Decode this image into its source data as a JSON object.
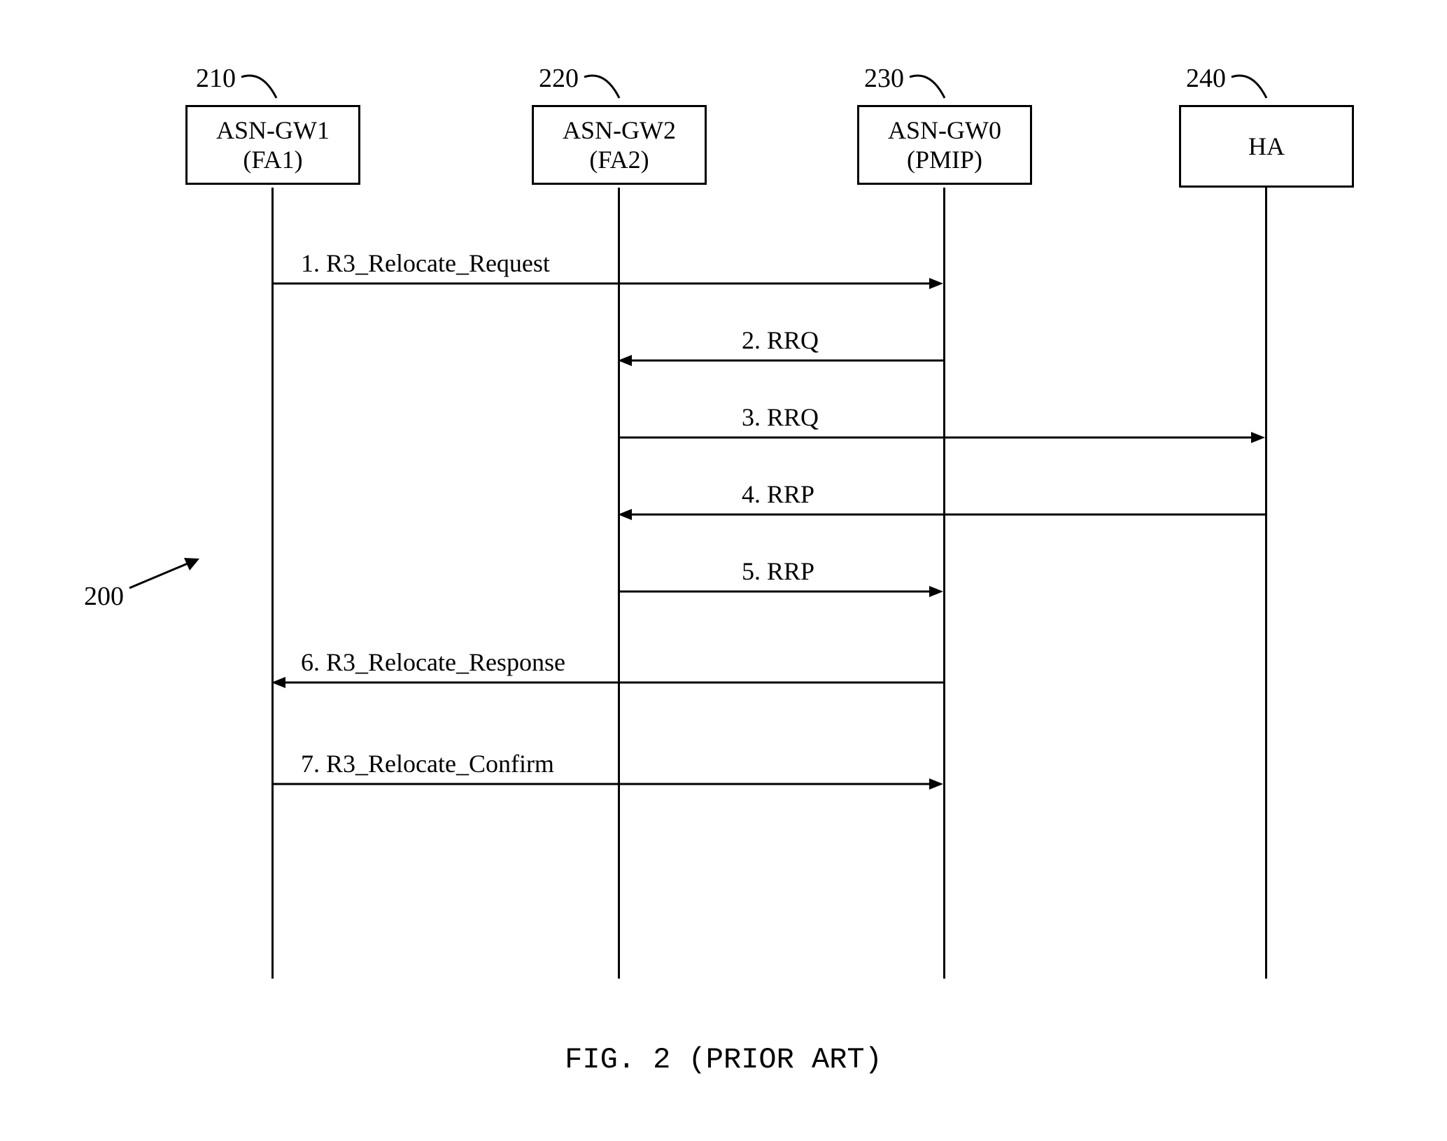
{
  "participants": [
    {
      "id": "p1",
      "ref": "210",
      "line1": "ASN-GW1",
      "line2": "(FA1)"
    },
    {
      "id": "p2",
      "ref": "220",
      "line1": "ASN-GW2",
      "line2": "(FA2)"
    },
    {
      "id": "p3",
      "ref": "230",
      "line1": "ASN-GW0",
      "line2": "(PMIP)"
    },
    {
      "id": "p4",
      "ref": "240",
      "line1": "HA",
      "line2": ""
    }
  ],
  "messages": [
    {
      "num": "1",
      "label": "1. R3_Relocate_Request"
    },
    {
      "num": "2",
      "label": "2. RRQ"
    },
    {
      "num": "3",
      "label": "3. RRQ"
    },
    {
      "num": "4",
      "label": "4. RRP"
    },
    {
      "num": "5",
      "label": "5. RRP"
    },
    {
      "num": "6",
      "label": "6. R3_Relocate_Response"
    },
    {
      "num": "7",
      "label": "7. R3_Relocate_Confirm"
    }
  ],
  "diagramRef": "200",
  "caption": "FIG. 2 (PRIOR ART)",
  "chart_data": {
    "type": "sequence_diagram",
    "title": "FIG. 2 (PRIOR ART)",
    "diagram_reference": "200",
    "participants": [
      {
        "name": "ASN-GW1 (FA1)",
        "ref": "210"
      },
      {
        "name": "ASN-GW2 (FA2)",
        "ref": "220"
      },
      {
        "name": "ASN-GW0 (PMIP)",
        "ref": "230"
      },
      {
        "name": "HA",
        "ref": "240"
      }
    ],
    "messages": [
      {
        "step": 1,
        "from": "ASN-GW1 (FA1)",
        "to": "ASN-GW0 (PMIP)",
        "label": "R3_Relocate_Request"
      },
      {
        "step": 2,
        "from": "ASN-GW0 (PMIP)",
        "to": "ASN-GW2 (FA2)",
        "label": "RRQ"
      },
      {
        "step": 3,
        "from": "ASN-GW2 (FA2)",
        "to": "HA",
        "label": "RRQ"
      },
      {
        "step": 4,
        "from": "HA",
        "to": "ASN-GW2 (FA2)",
        "label": "RRP"
      },
      {
        "step": 5,
        "from": "ASN-GW2 (FA2)",
        "to": "ASN-GW0 (PMIP)",
        "label": "RRP"
      },
      {
        "step": 6,
        "from": "ASN-GW0 (PMIP)",
        "to": "ASN-GW1 (FA1)",
        "label": "R3_Relocate_Response"
      },
      {
        "step": 7,
        "from": "ASN-GW1 (FA1)",
        "to": "ASN-GW0 (PMIP)",
        "label": "R3_Relocate_Confirm"
      }
    ]
  }
}
